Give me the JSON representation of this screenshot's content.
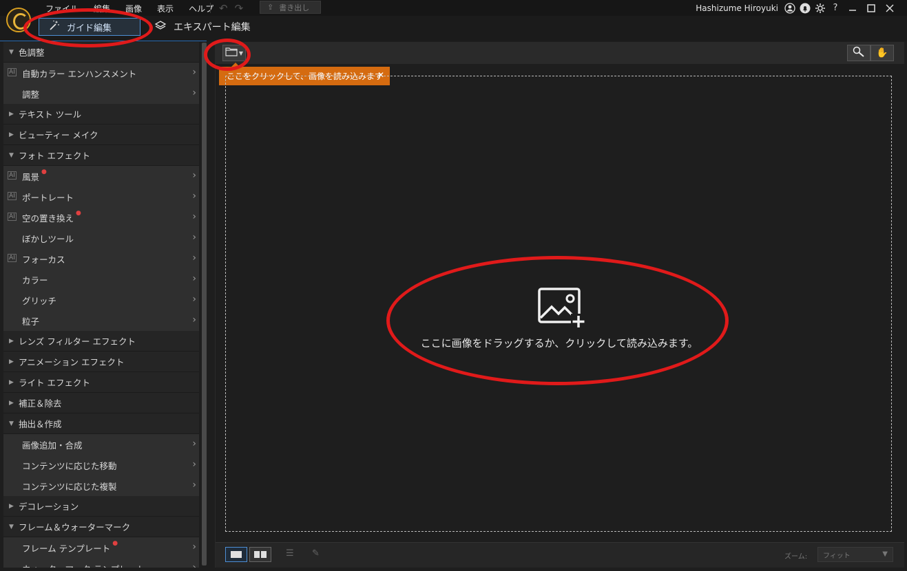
{
  "menu": [
    "ファイル",
    "編集",
    "画像",
    "表示",
    "ヘルプ"
  ],
  "export_label": "書き出し",
  "user": {
    "name": "Hashizume Hiroyuki",
    "help": "?"
  },
  "modes": {
    "guide": "ガイド編集",
    "expert": "エキスパート編集"
  },
  "sidebar": [
    {
      "type": "cat",
      "label": "色調整",
      "open": true
    },
    {
      "type": "item",
      "label": "自動カラー エンハンスメント",
      "ai": true
    },
    {
      "type": "item",
      "label": "調整"
    },
    {
      "type": "cat",
      "label": "テキスト ツール"
    },
    {
      "type": "cat",
      "label": "ビューティー メイク"
    },
    {
      "type": "cat",
      "label": "フォト エフェクト",
      "open": true
    },
    {
      "type": "item",
      "label": "風景",
      "ai": true,
      "new": true
    },
    {
      "type": "item",
      "label": "ポートレート",
      "ai": true
    },
    {
      "type": "item",
      "label": "空の置き換え",
      "ai": true,
      "new": true
    },
    {
      "type": "item",
      "label": "ぼかしツール"
    },
    {
      "type": "item",
      "label": "フォーカス",
      "ai": true
    },
    {
      "type": "item",
      "label": "カラー"
    },
    {
      "type": "item",
      "label": "グリッチ"
    },
    {
      "type": "item",
      "label": "粒子"
    },
    {
      "type": "cat",
      "label": "レンズ フィルター エフェクト"
    },
    {
      "type": "cat",
      "label": "アニメーション エフェクト"
    },
    {
      "type": "cat",
      "label": "ライト エフェクト"
    },
    {
      "type": "cat",
      "label": "補正＆除去"
    },
    {
      "type": "cat",
      "label": "抽出＆作成",
      "open": true
    },
    {
      "type": "item",
      "label": "画像追加・合成"
    },
    {
      "type": "item",
      "label": "コンテンツに応じた移動"
    },
    {
      "type": "item",
      "label": "コンテンツに応じた複製"
    },
    {
      "type": "cat",
      "label": "デコレーション"
    },
    {
      "type": "cat",
      "label": "フレーム＆ウォーターマーク",
      "open": true
    },
    {
      "type": "item",
      "label": "フレーム テンプレート",
      "new": true
    },
    {
      "type": "item",
      "label": "ウォーターマーク テンプレート"
    }
  ],
  "tooltip": "ここをクリックして、画像を読み込みます",
  "dropzone": {
    "text": "ここに画像をドラッグするか、クリックして読み込みます。"
  },
  "zoom": {
    "label": "ズーム:",
    "value": "フィット"
  },
  "colors": {
    "accent": "#4d8fd6",
    "tooltip": "#d56b10",
    "annotation": "#e01a1a"
  }
}
